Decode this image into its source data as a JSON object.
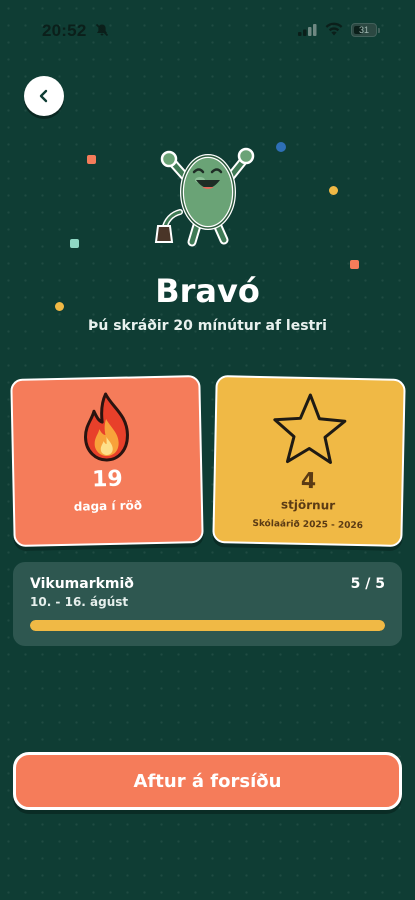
{
  "status_bar": {
    "time": "20:52",
    "battery": "31",
    "icons": [
      "bell-slash-icon",
      "signal-icon",
      "wifi-icon",
      "battery-icon"
    ]
  },
  "nav": {
    "back_icon": "chevron-left-icon"
  },
  "header": {
    "title": "Bravó",
    "subtitle": "Þú skráðir 20 mínútur af lestri"
  },
  "stats": {
    "streak": {
      "value": "19",
      "label": "daga í röð",
      "icon": "fire-icon"
    },
    "stars": {
      "value": "4",
      "label": "stjörnur",
      "sublabel": "Skólaárið 2025 - 2026",
      "icon": "star-icon"
    }
  },
  "weekly_goal": {
    "title": "Vikumarkmið",
    "dates": "10. - 16. ágúst",
    "count": "5 / 5",
    "progress": 1.0
  },
  "actions": {
    "home_label": "Aftur á forsíðu"
  },
  "colors": {
    "background": "#0f3d34",
    "coral": "#f57c5a",
    "yellow": "#f0b945",
    "panel": "#2e5750"
  }
}
